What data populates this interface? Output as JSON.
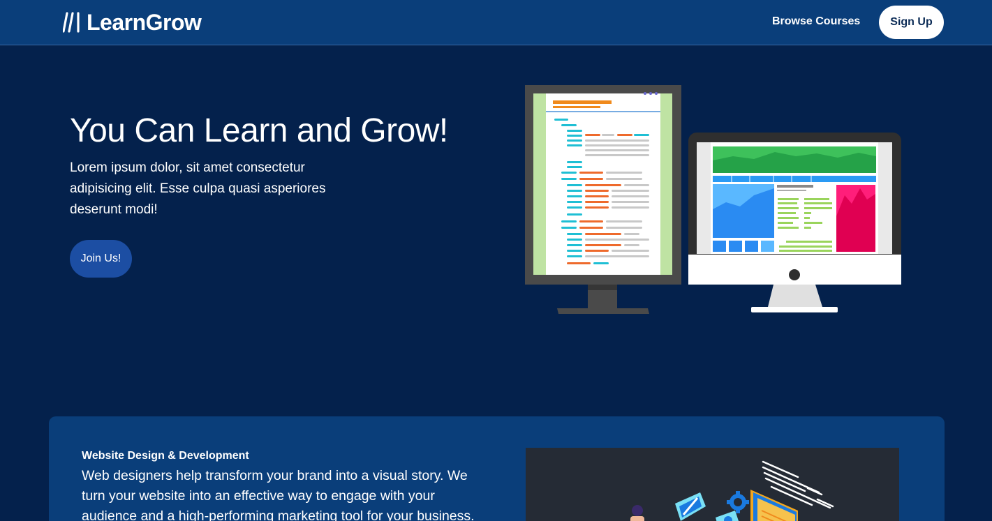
{
  "navbar": {
    "brand": "LearnGrow",
    "links": [
      {
        "label": "Browse Courses"
      }
    ],
    "signup_label": "Sign Up"
  },
  "hero": {
    "title": "You Can Learn and Grow!",
    "text": "Lorem ipsum dolor, sit amet consectetur adipisicing elit. Esse culpa quasi asperiores deserunt modi!",
    "button_label": "Join Us!"
  },
  "feature_card": {
    "title": "Website Design & Development",
    "text": "Web designers help transform your brand into a visual story. We turn your website into an effective way to engage with your audience and a high-performing marketing tool for your business."
  },
  "colors": {
    "page_background": "#04214c",
    "navbar_background": "#0a3e7a",
    "card_background": "#0a3e7a",
    "button_blue": "#1c4ea3",
    "white": "#ffffff"
  },
  "icons": {
    "brand": "brand-slashes-icon",
    "hero_image": "computer-monitors-illustration",
    "card_image": "web-development-illustration"
  }
}
